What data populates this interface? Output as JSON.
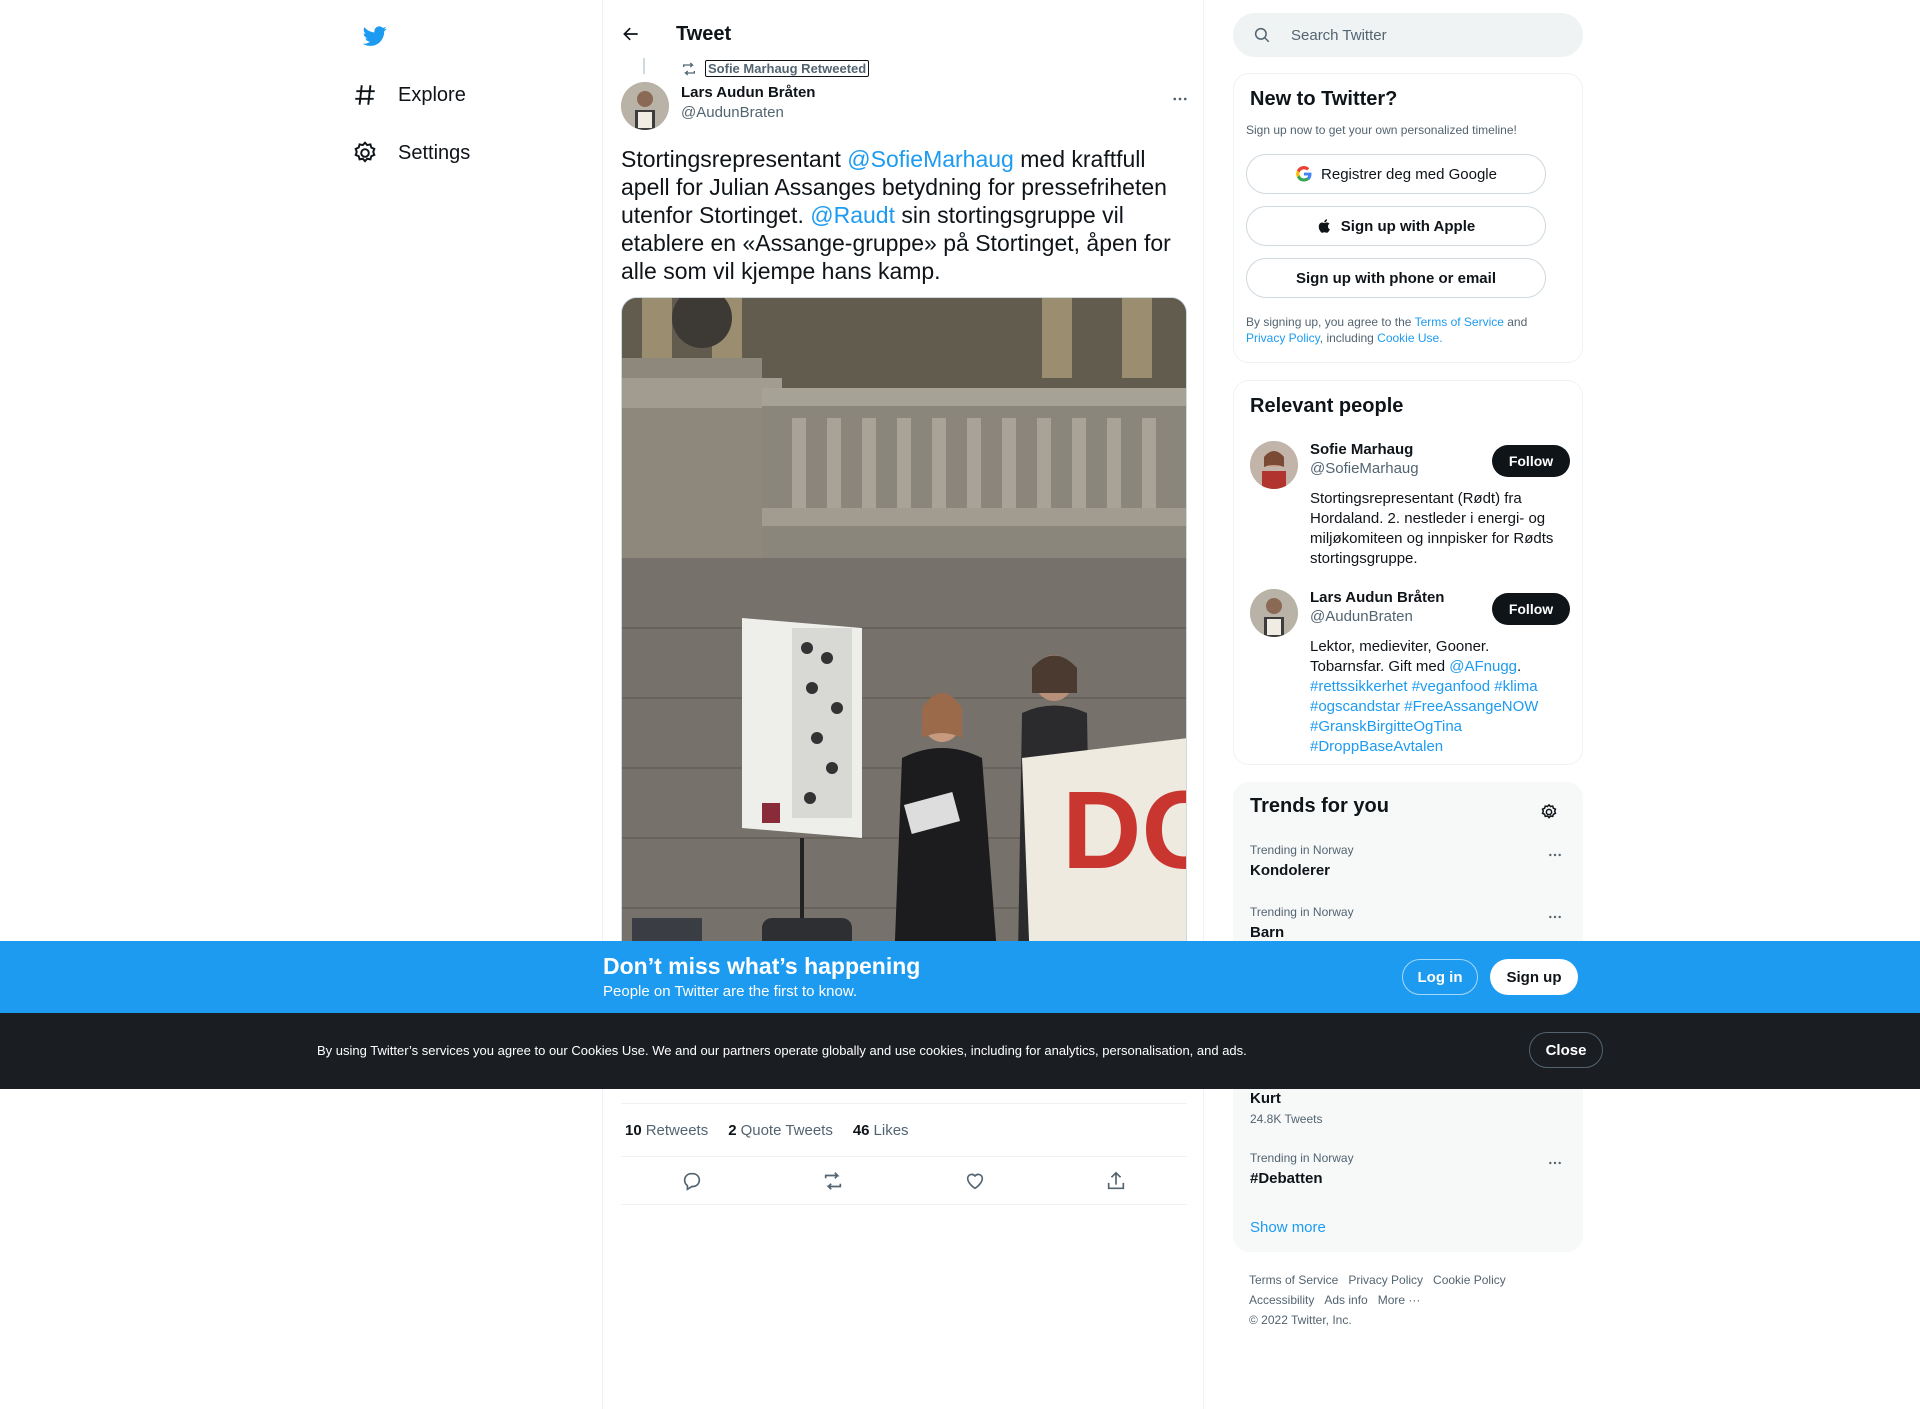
{
  "nav": {
    "explore_label": "Explore",
    "settings_label": "Settings"
  },
  "header": {
    "title": "Tweet"
  },
  "tweet": {
    "retweet_context": "Sofie Marhaug Retweeted",
    "author_name": "Lars Audun Bråten",
    "author_handle": "@AudunBraten",
    "text_part1": "Stortingsrepresentant ",
    "mention1": "@SofieMarhaug",
    "text_part2": " med kraftfull apell for Julian Assanges betydning for pressefriheten utenfor Stortinget. ",
    "mention2": "@Raudt",
    "text_part3": " sin stortingsgruppe vil etablere en «Assange-gruppe» på Stortinget, åpen for alle som vil kjempe hans kamp.",
    "retweets_count": "10",
    "retweets_label": "Retweets",
    "quotes_count": "2",
    "quotes_label": "Quote Tweets",
    "likes_count": "46",
    "likes_label": "Likes"
  },
  "search": {
    "placeholder": "Search Twitter"
  },
  "new_to_twitter": {
    "title": "New to Twitter?",
    "subtitle": "Sign up now to get your own personalized timeline!",
    "google_btn": "Registrer deg med Google",
    "apple_btn": "Sign up with Apple",
    "phone_btn": "Sign up with phone or email",
    "legal_prefix": "By signing up, you agree to the ",
    "legal_terms": "Terms of Service",
    "legal_and": " and ",
    "legal_privacy": "Privacy Policy",
    "legal_including": ", including ",
    "legal_cookie": "Cookie Use."
  },
  "relevant_people": {
    "title": "Relevant people",
    "follow_label": "Follow",
    "people": [
      {
        "name": "Sofie Marhaug",
        "handle": "@SofieMarhaug",
        "bio": "Stortingsrepresentant (Rødt) fra Hordaland. 2. nestleder i energi- og miljøkomiteen og innpisker for Rødts stortingsgruppe."
      },
      {
        "name": "Lars Audun Bråten",
        "handle": "@AudunBraten",
        "bio_text": "Lektor, medieviter, Gooner. Tobarnsfar. Gift med ",
        "bio_mention": "@AFnugg",
        "bio_end": ".",
        "bio_tags": "#rettssikkerhet #veganfood #klima #ogscandstar #FreeAssangeNOW #GranskBirgitteOgTina #DroppBaseAvtalen"
      }
    ]
  },
  "trends": {
    "title": "Trends for you",
    "items": [
      {
        "meta": "Trending in Norway",
        "name": "Kondolerer",
        "count": ""
      },
      {
        "meta": "Trending in Norway",
        "name": "Barn",
        "count": ""
      },
      {
        "meta": "",
        "name": "Kurt",
        "count": "24.8K Tweets"
      },
      {
        "meta": "Trending in Norway",
        "name": "#Debatten",
        "count": ""
      }
    ],
    "show_more": "Show more"
  },
  "footer": {
    "terms": "Terms of Service",
    "privacy": "Privacy Policy",
    "cookie": "Cookie Policy",
    "accessibility": "Accessibility",
    "ads": "Ads info",
    "more": "More ···",
    "copyright": "© 2022 Twitter, Inc."
  },
  "banner": {
    "title": "Don’t miss what’s happening",
    "subtitle": "People on Twitter are the first to know.",
    "login": "Log in",
    "signup": "Sign up"
  },
  "cookie_bar": {
    "text": "By using Twitter’s services you agree to our Cookies Use. We and our partners operate globally and use cookies, including for analytics, personalisation, and ads.",
    "close": "Close"
  },
  "colors": {
    "accent": "#1d9bf0",
    "text": "#0f1419",
    "muted": "#536471"
  }
}
